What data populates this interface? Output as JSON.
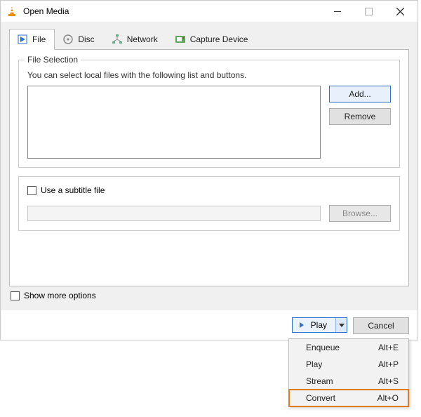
{
  "titlebar": {
    "title": "Open Media"
  },
  "tabs": {
    "file": "File",
    "disc": "Disc",
    "network": "Network",
    "capture": "Capture Device"
  },
  "fileSelection": {
    "legend": "File Selection",
    "help": "You can select local files with the following list and buttons.",
    "add": "Add...",
    "remove": "Remove"
  },
  "subtitle": {
    "label": "Use a subtitle file",
    "browse": "Browse..."
  },
  "showMore": "Show more options",
  "footer": {
    "play": "Play",
    "cancel": "Cancel"
  },
  "menu": {
    "items": [
      {
        "label": "Enqueue",
        "shortcut": "Alt+E"
      },
      {
        "label": "Play",
        "shortcut": "Alt+P"
      },
      {
        "label": "Stream",
        "shortcut": "Alt+S"
      },
      {
        "label": "Convert",
        "shortcut": "Alt+O"
      }
    ]
  }
}
